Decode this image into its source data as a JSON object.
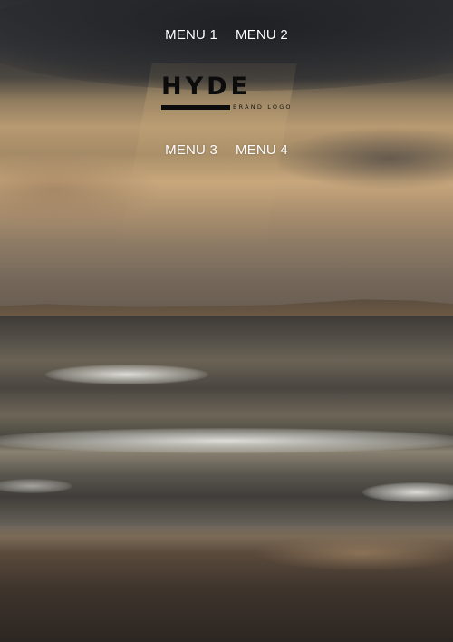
{
  "nav": {
    "top_items": [
      {
        "label": "MENU 1"
      },
      {
        "label": "MENU 2"
      }
    ],
    "bottom_items": [
      {
        "label": "MENU 3"
      },
      {
        "label": "MENU 4"
      }
    ]
  },
  "brand": {
    "name": "HYDE",
    "tagline": "BRAND LOGO",
    "color": "#0c0c0c"
  },
  "hero": {
    "image": "beach-seascape-background"
  },
  "colors": {
    "menu_text": "#ffffff"
  }
}
